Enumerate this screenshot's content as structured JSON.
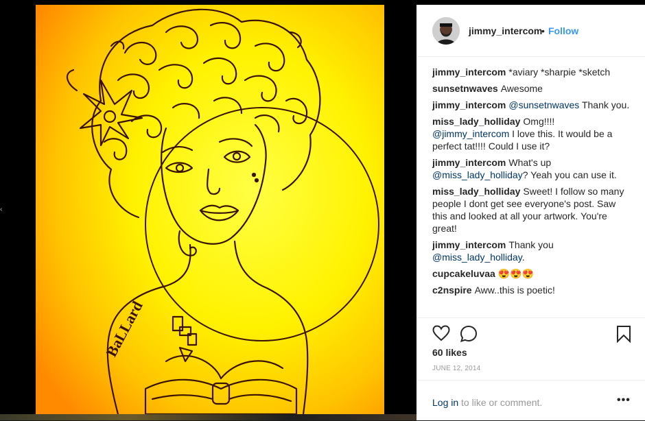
{
  "post": {
    "username": "jimmy_intercom",
    "separator": "•",
    "follow_label": "Follow",
    "likes": "60 likes",
    "date": "JUNE 12, 2014",
    "artwork_signature": "BaLLard"
  },
  "comments": [
    {
      "user": "jimmy_intercom",
      "parts": [
        {
          "t": "*aviary *sharpie *sketch",
          "m": false
        }
      ]
    },
    {
      "user": "sunsetnwaves",
      "parts": [
        {
          "t": "Awesome",
          "m": false
        }
      ]
    },
    {
      "user": "jimmy_intercom",
      "parts": [
        {
          "t": "@sunsetnwaves",
          "m": true
        },
        {
          "t": " Thank you.",
          "m": false
        }
      ]
    },
    {
      "user": "miss_lady_holliday",
      "parts": [
        {
          "t": "Omg!!!! ",
          "m": false
        },
        {
          "t": "@jimmy_intercom",
          "m": true
        },
        {
          "t": " I love this. It would be a perfect tat!!!! Could I use it?",
          "m": false
        }
      ]
    },
    {
      "user": "jimmy_intercom",
      "parts": [
        {
          "t": "What's up ",
          "m": false
        },
        {
          "t": "@miss_lady_holliday",
          "m": true
        },
        {
          "t": "? Yeah you can use it.",
          "m": false
        }
      ]
    },
    {
      "user": "miss_lady_holliday",
      "parts": [
        {
          "t": "Sweet! I follow so many people I dont get see everyone's post. Saw this and looked at all your artwork. You're great!",
          "m": false
        }
      ]
    },
    {
      "user": "jimmy_intercom",
      "parts": [
        {
          "t": "Thank you ",
          "m": false
        },
        {
          "t": "@miss_lady_holliday",
          "m": true
        },
        {
          "t": ".",
          "m": false
        }
      ]
    },
    {
      "user": "cupcakeluvaa",
      "parts": [
        {
          "t": "😍😍😍",
          "m": false
        }
      ]
    },
    {
      "user": "c2nspire",
      "parts": [
        {
          "t": "Aww..this is poetic!",
          "m": false
        }
      ]
    }
  ],
  "footer": {
    "login_link": "Log in",
    "login_rest": " to like or comment.",
    "more_label": "•••"
  },
  "colors": {
    "follow": "#3897f0",
    "mention": "#003569",
    "muted": "#999999",
    "artwork_bg_center": "#ffff33",
    "artwork_bg_edge": "#ff8800",
    "ink": "#3a1200"
  },
  "icons": [
    "heart-icon",
    "comment-icon",
    "bookmark-icon",
    "more-options-icon"
  ]
}
